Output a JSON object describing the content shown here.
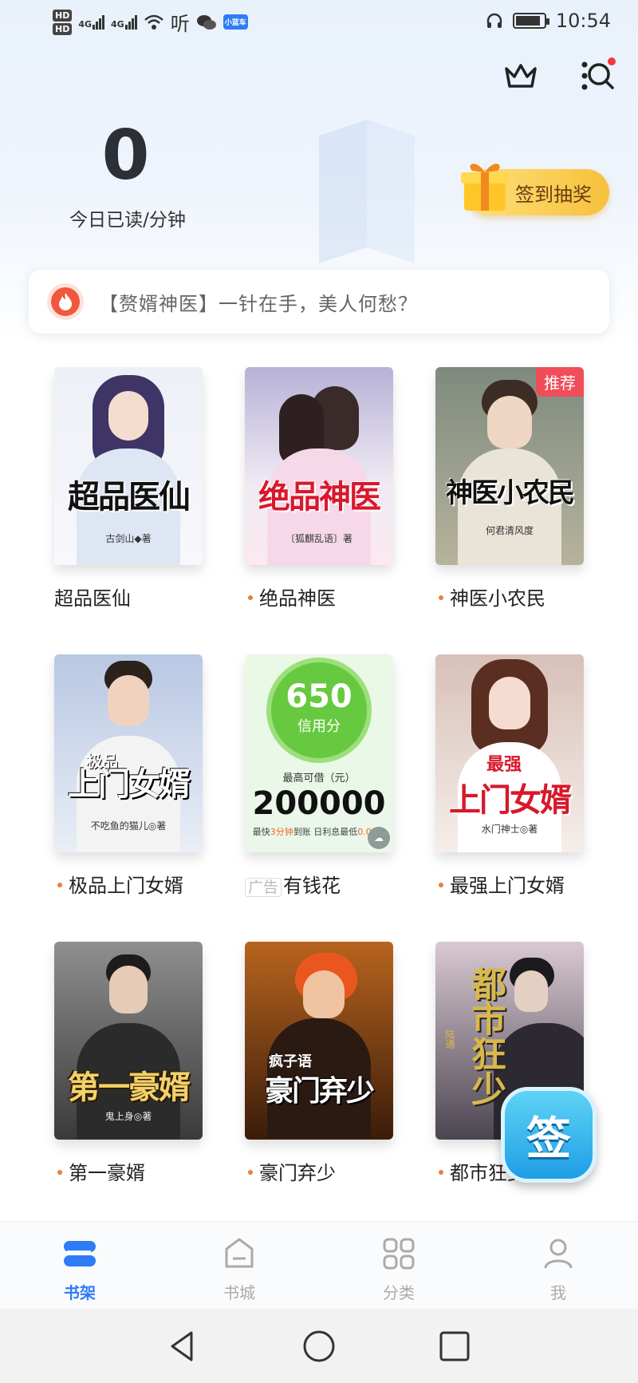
{
  "status_bar": {
    "hd_top": "HD",
    "hd_bottom": "HD",
    "net1": "4G",
    "net2": "4G",
    "listen": "听",
    "mini_app": "小蓝车",
    "time": "10:54"
  },
  "header": {
    "today_value": "0",
    "today_label": "今日已读/分钟",
    "sign_lottery_label": "签到抽奖"
  },
  "notice": {
    "text": "【赘婿神医】一针在手，美人何愁？"
  },
  "books": [
    {
      "name": "超品医仙",
      "cover_title": "超品医仙",
      "cover_author": "古剑山◆著",
      "dot": false
    },
    {
      "name": "绝品神医",
      "cover_title": "绝品神医",
      "cover_author": "〔狐麒乱语〕著",
      "dot": true
    },
    {
      "name": "神医小农民",
      "cover_title": "神医小农民",
      "cover_author": "何君清风度",
      "dot": true,
      "badge": "推荐"
    },
    {
      "name": "极品上门女婿",
      "cover_title": "上门女婿",
      "cover_subtitle": "极品",
      "cover_author": "不吃鱼的猫儿◎著",
      "dot": true
    },
    {
      "name": "有钱花",
      "ad_tag": "广告",
      "ad": {
        "score": "650",
        "score_label": "信用分",
        "line1": "最高可借（元）",
        "amount": "200000",
        "line3a": "最快",
        "line3b": "3分钟",
        "line3c": "到账 日利息最低",
        "line3d": "0.02%"
      }
    },
    {
      "name": "最强上门女婿",
      "cover_title": "上门女婿",
      "cover_subtitle": "最强",
      "cover_author": "水门神士◎著",
      "dot": true
    },
    {
      "name": "第一豪婿",
      "cover_title": "第一豪婿",
      "cover_author": "鬼上身◎著",
      "dot": true
    },
    {
      "name": "豪门弃少",
      "cover_title": "豪门弃少",
      "cover_subtitle": "疯子语",
      "dot": true
    },
    {
      "name": "都市狂少",
      "cover_title": "都市狂少",
      "cover_author": "陆通",
      "dot": true
    }
  ],
  "float_sign": "签",
  "bottom_nav": [
    {
      "label": "书架",
      "active": true
    },
    {
      "label": "书城",
      "active": false
    },
    {
      "label": "分类",
      "active": false
    },
    {
      "label": "我",
      "active": false
    }
  ],
  "colors": {
    "accent": "#2d7cf6",
    "badge": "#f04d5a",
    "dot": "#f07b3f"
  }
}
